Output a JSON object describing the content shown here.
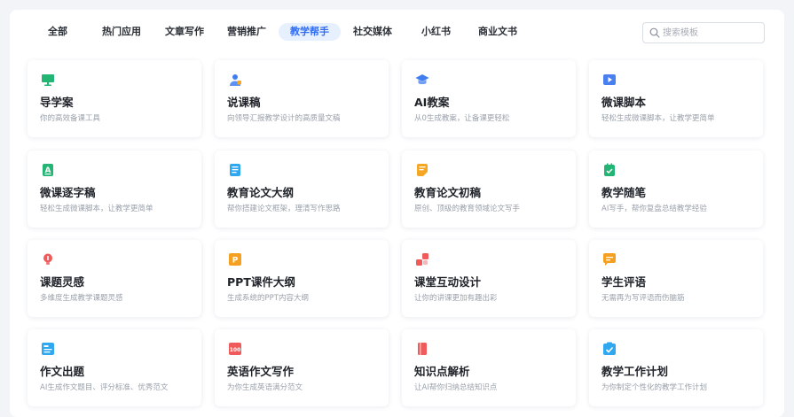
{
  "tabs": [
    {
      "label": "全部",
      "active": false
    },
    {
      "label": "热门应用",
      "active": false
    },
    {
      "label": "文章写作",
      "active": false
    },
    {
      "label": "营销推广",
      "active": false
    },
    {
      "label": "教学帮手",
      "active": true
    },
    {
      "label": "社交媒体",
      "active": false
    },
    {
      "label": "小红书",
      "active": false
    },
    {
      "label": "商业文书",
      "active": false
    }
  ],
  "search": {
    "placeholder": "搜索模板"
  },
  "colors": {
    "accent": "#2f6df6",
    "active_tab_bg": "#e7f0ff"
  },
  "cards": [
    {
      "title": "导学案",
      "desc": "你的高效备课工具",
      "icon": "chalkboard-icon",
      "color": "#22b573"
    },
    {
      "title": "说课稿",
      "desc": "向领导汇报教学设计的高质量文稿",
      "icon": "presenter-icon",
      "color": "#3f7df0"
    },
    {
      "title": "AI教案",
      "desc": "从0生成教案，让备课更轻松",
      "icon": "graduation-cap-icon",
      "color": "#3f7df0"
    },
    {
      "title": "微课脚本",
      "desc": "轻松生成微课脚本，让教学更简单",
      "icon": "video-play-icon",
      "color": "#4a7ff0"
    },
    {
      "title": "微课逐字稿",
      "desc": "轻松生成微课脚本，让教学更简单",
      "icon": "letter-a-doc-icon",
      "color": "#22b573"
    },
    {
      "title": "教育论文大纲",
      "desc": "帮你搭建论文框架，理清写作思路",
      "icon": "document-list-icon",
      "color": "#2fa8f0"
    },
    {
      "title": "教育论文初稿",
      "desc": "原创、顶级的教育领域论文写手",
      "icon": "document-edit-icon",
      "color": "#f5a623"
    },
    {
      "title": "教学随笔",
      "desc": "AI写手，帮你复盘总结教学经验",
      "icon": "notebook-icon",
      "color": "#22b573"
    },
    {
      "title": "课题灵感",
      "desc": "多维度生成教学课题灵感",
      "icon": "lightbulb-icon",
      "color": "#f05a5a"
    },
    {
      "title": "PPT课件大纲",
      "desc": "生成系统的PPT内容大纲",
      "icon": "ppt-icon",
      "color": "#f5a020"
    },
    {
      "title": "课堂互动设计",
      "desc": "让你的讲课更加有趣出彩",
      "icon": "interaction-blocks-icon",
      "color": "#f05a5a"
    },
    {
      "title": "学生评语",
      "desc": "无需再为写评语而伤脑筋",
      "icon": "comment-icon",
      "color": "#f5a020"
    },
    {
      "title": "作文出题",
      "desc": "AI生成作文题目、评分标准、优秀范文",
      "icon": "essay-topic-icon",
      "color": "#2fa8f0"
    },
    {
      "title": "英语作文写作",
      "desc": "为你生成英语满分范文",
      "icon": "english-essay-icon",
      "color": "#f05a5a"
    },
    {
      "title": "知识点解析",
      "desc": "让AI帮你归纳总结知识点",
      "icon": "book-icon",
      "color": "#f05a5a"
    },
    {
      "title": "教学工作计划",
      "desc": "为你制定个性化的教学工作计划",
      "icon": "checklist-icon",
      "color": "#2fa8f0"
    }
  ]
}
